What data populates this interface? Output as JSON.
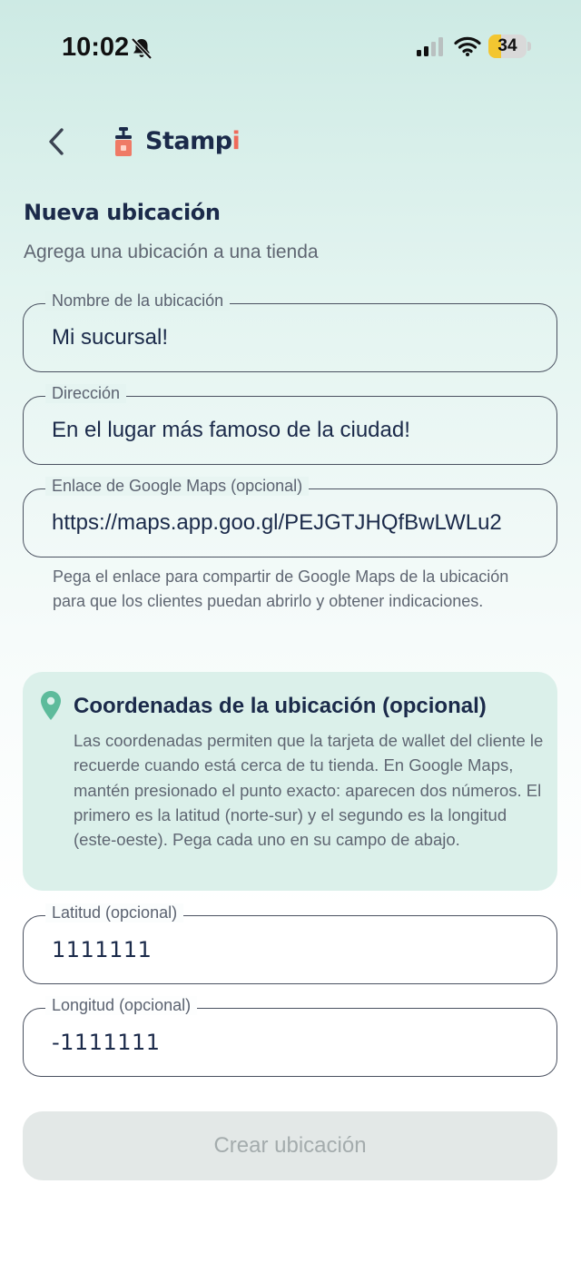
{
  "status_bar": {
    "time": "10:02",
    "battery_percent": 34,
    "battery_label": "34"
  },
  "header": {
    "brand_main": "Stamp",
    "brand_accent": "i"
  },
  "page": {
    "title": "Nueva ubicación",
    "subtitle": "Agrega una ubicación a una tienda"
  },
  "form": {
    "name": {
      "label": "Nombre de la ubicación",
      "value": "Mi sucursal!"
    },
    "address": {
      "label": "Dirección",
      "value": "En el lugar más famoso de la ciudad!"
    },
    "maps_link": {
      "label": "Enlace de Google Maps (opcional)",
      "value": "https://maps.app.goo.gl/PEJGTJHQfBwLWLu2",
      "helper": "Pega el enlace para compartir de Google Maps de la ubicación para que los clientes puedan abrirlo y obtener indicaciones."
    },
    "latitude": {
      "label": "Latitud (opcional)",
      "value": "1111111"
    },
    "longitude": {
      "label": "Longitud (opcional)",
      "value": "-1111111"
    },
    "submit_label": "Crear ubicación"
  },
  "info_card": {
    "icon": "map-pin-icon",
    "title": "Coordenadas de la ubicación (opcional)",
    "body": "Las coordenadas permiten que la tarjeta de wallet del cliente le recuerde cuando está cerca de tu tienda. En Google Maps, mantén presionado el punto exacto: aparecen dos números. El primero es la latitud (norte-sur) y el segundo es la longitud (este-oeste). Pega cada uno en su campo de abajo."
  },
  "colors": {
    "accent": "#ef6a5a",
    "pin": "#5dbb9b",
    "card_bg": "#dbf0ea",
    "text_dark": "#1b2a4a"
  }
}
